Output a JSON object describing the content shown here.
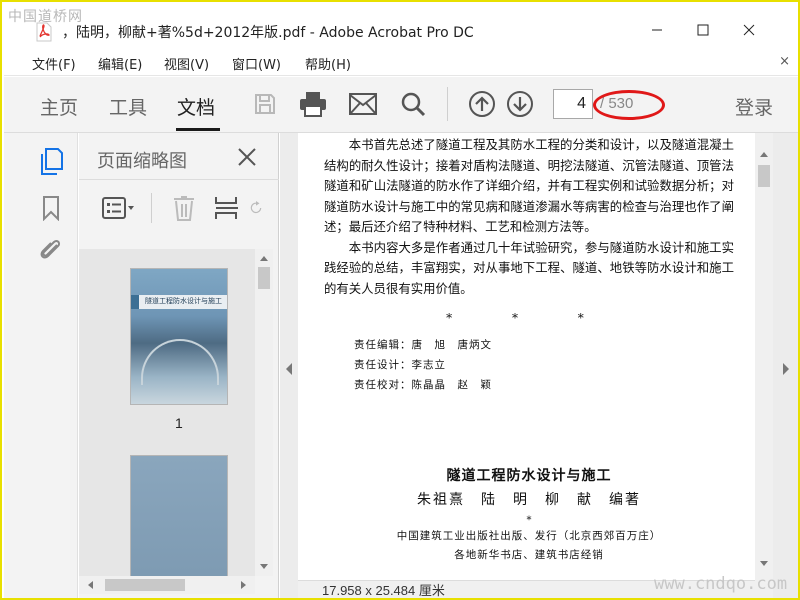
{
  "watermarks": {
    "top_left": "中国道桥网",
    "bottom_right": "www.cndqo.com"
  },
  "window": {
    "title": "，陆明，柳献+著%5d+2012年版.pdf - Adobe Acrobat Pro DC"
  },
  "menubar": {
    "items": [
      "文件(F)",
      "编辑(E)",
      "视图(V)",
      "窗口(W)",
      "帮助(H)"
    ],
    "close_glyph": "×"
  },
  "toolbar": {
    "tabs": [
      "主页",
      "工具",
      "文档"
    ],
    "active_tab": "文档",
    "icons": [
      "save-icon",
      "print-icon",
      "mail-icon",
      "search-icon",
      "page-up-icon",
      "page-down-icon"
    ],
    "current_page": "4",
    "total_pages": "/ 530",
    "login_label": "登录",
    "highlight_color": "#e01818"
  },
  "rail": {
    "icons": [
      "page-thumbnails-icon",
      "bookmark-icon",
      "attachment-icon"
    ],
    "accent": "#1473e6"
  },
  "panel": {
    "title": "页面缩略图",
    "thumbnails": [
      {
        "label": "1",
        "cover_title": "隧道工程防水设计与施工"
      },
      {
        "label": ""
      }
    ]
  },
  "document": {
    "paragraphs": [
      "本书首先总述了隧道工程及其防水工程的分类和设计，以及隧道混凝土结构的耐久性设计；接着对盾构法隧道、明挖法隧道、沉管法隧道、顶管法隧道和矿山法隧道的防水作了详细介绍，并有工程实例和试验数据分析；对隧道防水设计与施工中的常见病和隧道渗漏水等病害的检查与治理也作了阐述；最后还介绍了特种材料、工艺和检测方法等。",
      "本书内容大多是作者通过几十年试验研究，参与隧道防水设计和施工实践经验的总结，丰富翔实，对从事地下工程、隧道、地铁等防水设计和施工的有关人员很有实用价值。"
    ],
    "separator": "* * *",
    "credits": [
      "责任编辑：唐　旭　唐炳文",
      "责任设计：李志立",
      "责任校对：陈晶晶　赵　颖"
    ],
    "book_title": "隧道工程防水设计与施工",
    "book_authors": "朱祖熹　陆　明　柳　献　编著",
    "pub_star": "*",
    "publisher": "中国建筑工业出版社出版、发行（北京西郊百万庄）",
    "distributor": "各地新华书店、建筑书店经销"
  },
  "status": {
    "page_size": "17.958 x 25.484 厘米"
  }
}
